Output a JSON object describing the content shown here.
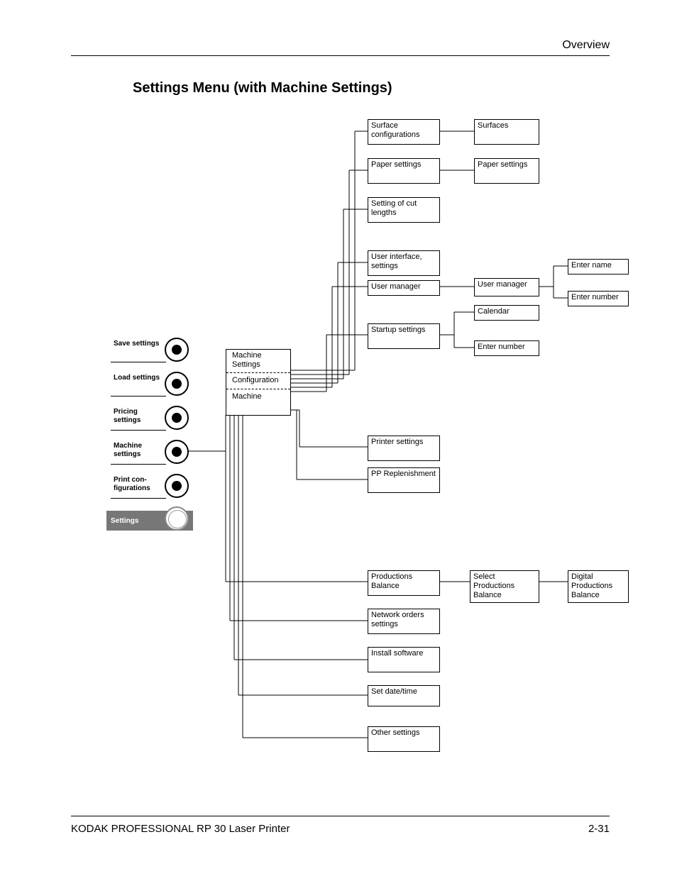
{
  "header": {
    "section": "Overview"
  },
  "title": "Settings Menu (with Machine Settings)",
  "footer": {
    "left": "KODAK PROFESSIONAL RP 30 Laser Printer",
    "right": "2-31"
  },
  "menu": {
    "save": "Save settings",
    "load": "Load settings",
    "pricing": "Pricing settings",
    "machine": "Machine settings",
    "print": "Print con-\nfigurations",
    "settings_tab": "Settings"
  },
  "hub": {
    "machine_settings": "Machine Settings",
    "configuration": "Configuration",
    "machine": "Machine"
  },
  "col2": {
    "surface": "Surface configurations",
    "paper": "Paper settings",
    "cut": "Setting of cut lengths",
    "ui": "User interface, settings",
    "usermgr": "User manager",
    "startup": "Startup settings",
    "printer": "Printer settings",
    "pp": "PP Replenishment",
    "prodbal": "Productions Balance",
    "network": "Network orders settings",
    "install": "Install software",
    "datetime": "Set date/time",
    "other": "Other settings"
  },
  "col3": {
    "surfaces": "Surfaces",
    "paper": "Paper settings",
    "usermgr": "User manager",
    "calendar": "Calendar",
    "enternum": "Enter number",
    "selprod": "Select Productions Balance"
  },
  "col4": {
    "entername": "Enter name",
    "enternum": "Enter number",
    "digprod": "Digital Productions Balance"
  }
}
